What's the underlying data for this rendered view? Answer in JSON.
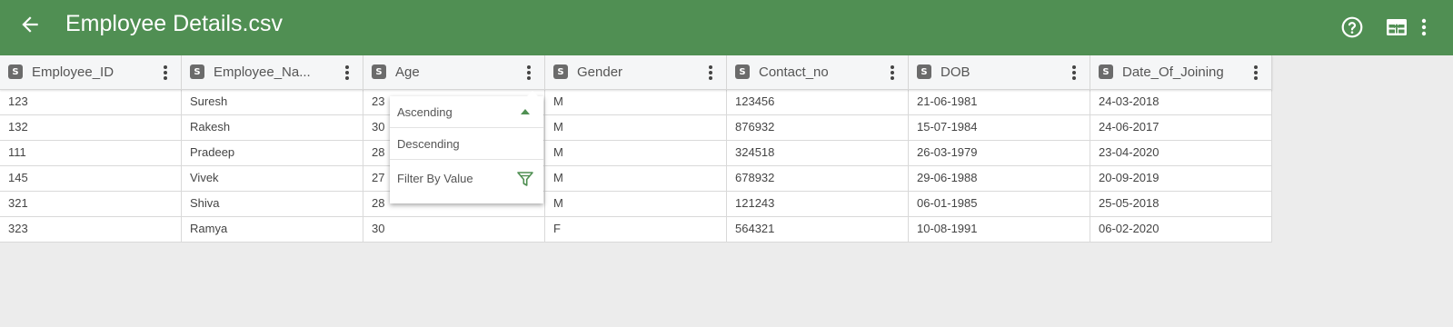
{
  "app": {
    "title": "Employee Details.csv",
    "icons": {
      "back": "back-arrow-icon",
      "help": "help-circle-icon",
      "export": "table-export-icon",
      "more": "more-vert-icon"
    },
    "colors": {
      "appbar": "#508f53",
      "accent": "#4f8f52"
    }
  },
  "table": {
    "columns": [
      {
        "type": "S",
        "name": "Employee_ID"
      },
      {
        "type": "S",
        "name": "Employee_Na..."
      },
      {
        "type": "S",
        "name": "Age"
      },
      {
        "type": "S",
        "name": "Gender"
      },
      {
        "type": "S",
        "name": "Contact_no"
      },
      {
        "type": "S",
        "name": "DOB"
      },
      {
        "type": "S",
        "name": "Date_Of_Joining"
      }
    ],
    "rows": [
      [
        "123",
        "Suresh",
        "23",
        "M",
        "123456",
        "21-06-1981",
        "24-03-2018"
      ],
      [
        "132",
        "Rakesh",
        "30",
        "M",
        "876932",
        "15-07-1984",
        "24-06-2017"
      ],
      [
        "111",
        "Pradeep",
        "28",
        "M",
        "324518",
        "26-03-1979",
        "23-04-2020"
      ],
      [
        "145",
        "Vivek",
        "27",
        "M",
        "678932",
        "29-06-1988",
        "20-09-2019"
      ],
      [
        "321",
        "Shiva",
        "28",
        "M",
        "121243",
        "06-01-1985",
        "25-05-2018"
      ],
      [
        "323",
        "Ramya",
        "30",
        "F",
        "564321",
        "10-08-1991",
        "06-02-2020"
      ]
    ]
  },
  "column_menu": {
    "column": "Age",
    "items": [
      {
        "label": "Ascending",
        "icon": "sort-ascending-icon"
      },
      {
        "label": "Descending",
        "icon": ""
      },
      {
        "label": "Filter By Value",
        "icon": "filter-icon"
      }
    ]
  }
}
